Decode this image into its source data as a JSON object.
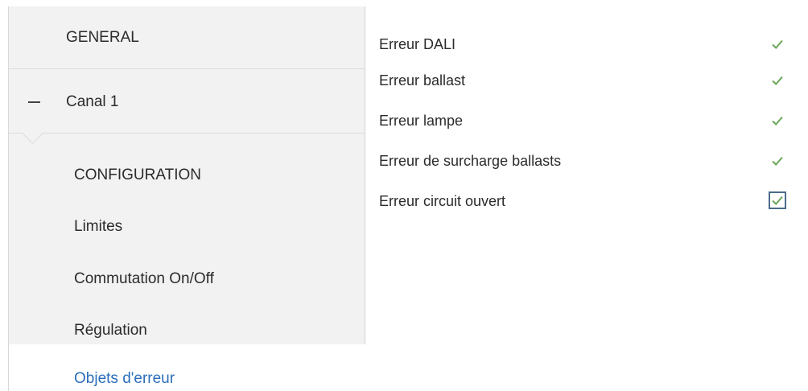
{
  "tree": {
    "general": {
      "label": "GENERAL"
    },
    "canal": {
      "label": "Canal 1",
      "expanded": true,
      "icon": "minus-icon",
      "children": [
        {
          "label": "CONFIGURATION"
        },
        {
          "label": "Limites"
        },
        {
          "label": "Commutation On/Off"
        },
        {
          "label": "Régulation"
        },
        {
          "label": "Objets d'erreur",
          "selected": true
        }
      ]
    }
  },
  "parameters": [
    {
      "label": "Erreur DALI",
      "checked": true,
      "focused": false
    },
    {
      "label": "Erreur ballast",
      "checked": true,
      "focused": false
    },
    {
      "label": "Erreur lampe",
      "checked": true,
      "focused": false
    },
    {
      "label": "Erreur de surcharge ballasts",
      "checked": true,
      "focused": false
    },
    {
      "label": "Erreur circuit ouvert",
      "checked": true,
      "focused": true
    }
  ],
  "colors": {
    "check": "#6aa85a",
    "selected_text": "#2a6ebb",
    "tree_background": "#f2f2f2",
    "focus_border": "#4a6b8a"
  }
}
